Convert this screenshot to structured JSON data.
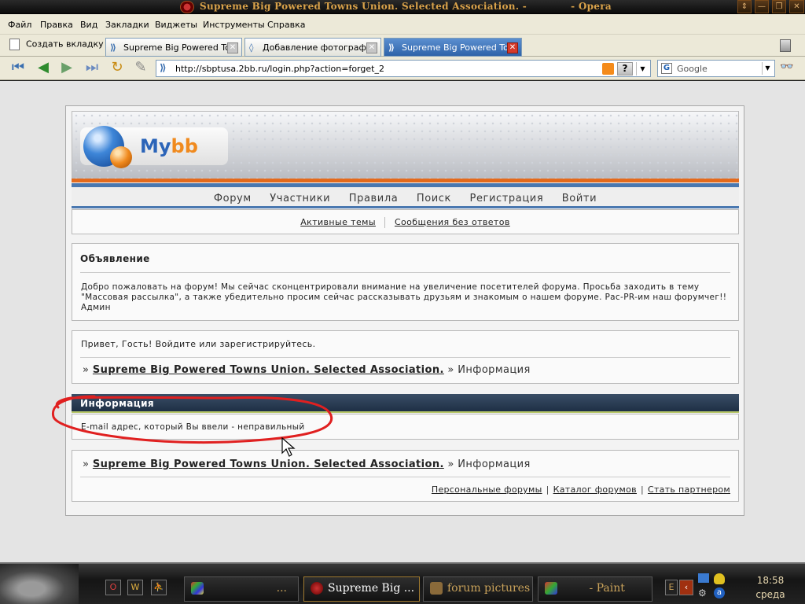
{
  "window": {
    "title": "Supreme Big Powered Towns Union. Selected Association. -",
    "app": "- Opera",
    "buttons": [
      "⇕",
      "—",
      "❐",
      "✕"
    ]
  },
  "menu": [
    "Файл",
    "Правка",
    "Вид",
    "Закладки",
    "Виджеты",
    "Инструменты",
    "Справка"
  ],
  "tabs": {
    "new_tab": "Создать вкладку",
    "items": [
      {
        "label": "Supreme Big Powered To...",
        "icon": "opera-page-icon",
        "active": false
      },
      {
        "label": "Добавление фотограф...",
        "icon": "site-icon",
        "active": false
      },
      {
        "label": "Supreme Big Powered To...",
        "icon": "opera-page-icon",
        "active": true
      }
    ]
  },
  "toolbar": {
    "url": "http://sbptusa.2bb.ru/login.php?action=forget_2",
    "search_engine": "Google",
    "help": "?"
  },
  "site": {
    "logo_main": "My",
    "logo_accent": "bb",
    "nav": [
      "Форум",
      "Участники",
      "Правила",
      "Поиск",
      "Регистрация",
      "Войти"
    ],
    "subnav": [
      "Активные темы",
      "Сообщения без ответов"
    ],
    "announcement": {
      "title": "Объявление",
      "text": "Добро пожаловать на форум! Мы сейчас сконцентрировали внимание на увеличение посетителей форума. Просьба заходить в тему \"Массовая рассылка\", а также убедительно просим сейчас рассказывать друзьям и знакомым о нашем форуме. Рас-PR-им наш форумчег!! Админ"
    },
    "welcome": "Привет, Гость!  Войдите или зарегистрируйтесь.",
    "breadcrumb": {
      "sep": "»",
      "forum": "Supreme Big Powered Towns Union. Selected Association.",
      "current": "Информация"
    },
    "info": {
      "title": "Информация",
      "message": "E-mail адрес, который Вы ввели - неправильный"
    },
    "footer_links": [
      "Персональные форумы",
      "Каталог форумов",
      "Стать партнером"
    ]
  },
  "taskbar": {
    "quicklaunch": [
      "O",
      "W",
      "⛹"
    ],
    "items": [
      {
        "label": "...",
        "active": false
      },
      {
        "label": "Supreme Big ...",
        "active": true
      },
      {
        "label": "forum pictures",
        "active": false
      },
      {
        "label": "- Paint",
        "active": false
      }
    ],
    "time": "18:58",
    "day": "среда"
  },
  "colors": {
    "header_orange": "#e46a1c",
    "header_blue": "#4a78b0",
    "info_bar": "#2a3d55",
    "annotation_red": "#e02020",
    "active_tab": "#3a72bd"
  }
}
